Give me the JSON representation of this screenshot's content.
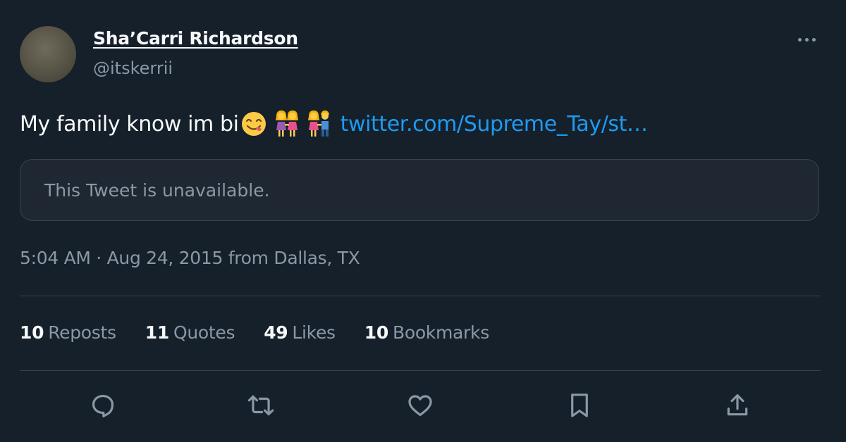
{
  "author": {
    "display_name": "Sha’Carri Richardson",
    "handle": "@itskerrii"
  },
  "tweet": {
    "text": "My family know im bi",
    "emojis": [
      "face-savoring-food-emoji",
      "women-holding-hands-emoji",
      "woman-and-man-holding-hands-emoji"
    ],
    "link_text": "twitter.com/Supreme_Tay/st…",
    "quote_unavailable": "This Tweet is unavailable.",
    "timestamp": "5:04 AM · Aug 24, 2015 from Dallas, TX"
  },
  "stats": [
    {
      "count": "10",
      "label": "Reposts"
    },
    {
      "count": "11",
      "label": "Quotes"
    },
    {
      "count": "49",
      "label": "Likes"
    },
    {
      "count": "10",
      "label": "Bookmarks"
    }
  ],
  "actions": [
    "reply-icon",
    "repost-icon",
    "like-icon",
    "bookmark-icon",
    "share-icon"
  ],
  "colors": {
    "background": "#15202b",
    "primary_text": "#f7f9f9",
    "secondary_text": "#8b98a5",
    "link": "#1d9bf0",
    "border": "#38444d",
    "card_background": "#1e2732"
  }
}
